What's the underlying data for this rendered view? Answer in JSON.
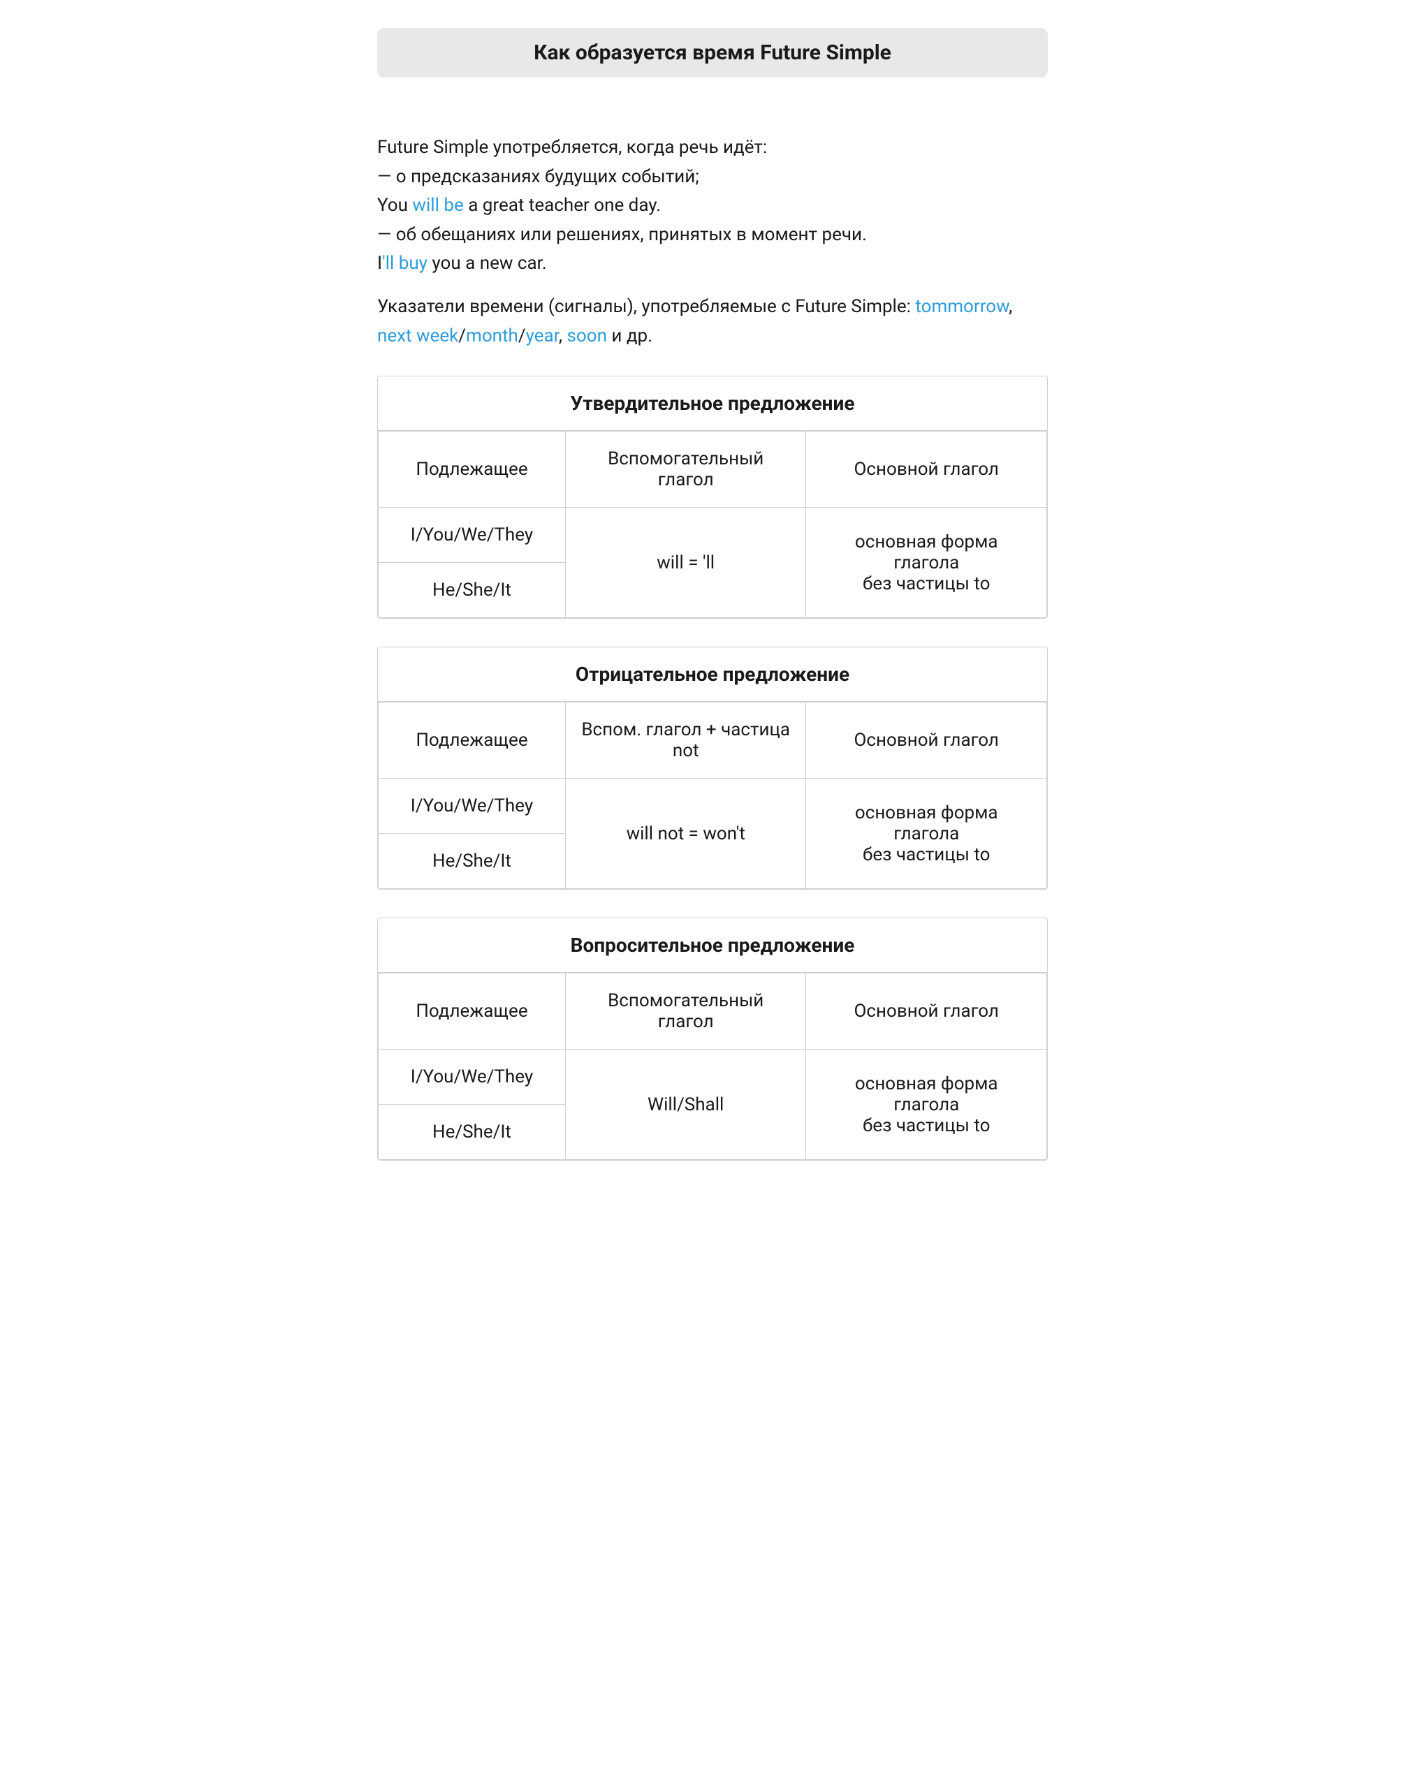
{
  "page": {
    "title": "Как образуется время Future Simple",
    "intro": {
      "line1": "Future Simple употребляется, когда речь идёт:",
      "line2": "— о предсказаниях будущих событий;",
      "line3_prefix": "You ",
      "line3_highlight": "will be",
      "line3_suffix": " a great teacher one day.",
      "line4": "— об обещаниях или решениях, принятых в момент речи.",
      "line5_prefix": "I",
      "line5_highlight": "'ll buy",
      "line5_suffix": " you a new car.",
      "line6_prefix": "Указатели времени (сигналы), употребляемые с Future Simple: ",
      "signals": [
        {
          "text": "tommorrow",
          "highlight": true
        },
        {
          "text": ", "
        },
        {
          "text": "next week",
          "highlight": true
        },
        {
          "text": "/"
        },
        {
          "text": "month",
          "highlight": true
        },
        {
          "text": "/"
        },
        {
          "text": "year",
          "highlight": true
        },
        {
          "text": ", "
        },
        {
          "text": "soon",
          "highlight": true
        },
        {
          "text": " и др."
        }
      ]
    },
    "affirmative": {
      "section_title": "Утвердительное предложение",
      "headers": [
        "Подлежащее",
        "Вспомогательный глагол",
        "Основной глагол"
      ],
      "subject_top": "I/You/We/They",
      "subject_bottom": "He/She/It",
      "aux_verb": "will = 'll",
      "main_verb_line1": "основная форма глагола",
      "main_verb_line2": "без частицы to"
    },
    "negative": {
      "section_title": "Отрицательное предложение",
      "headers": [
        "Подлежащее",
        "Вспом. глагол + частица not",
        "Основной глагол"
      ],
      "subject_top": "I/You/We/They",
      "subject_bottom": "He/She/It",
      "aux_verb": "will not = won't",
      "main_verb_line1": "основная форма глагола",
      "main_verb_line2": "без частицы to"
    },
    "interrogative": {
      "section_title": "Вопросительное предложение",
      "headers": [
        "Подлежащее",
        "Вспомогательный глагол",
        "Основной глагол"
      ],
      "subject_top": "I/You/We/They",
      "subject_bottom": "He/She/It",
      "aux_verb": "Will/Shall",
      "main_verb_line1": "основная форма глагола",
      "main_verb_line2": "без частицы to"
    }
  }
}
